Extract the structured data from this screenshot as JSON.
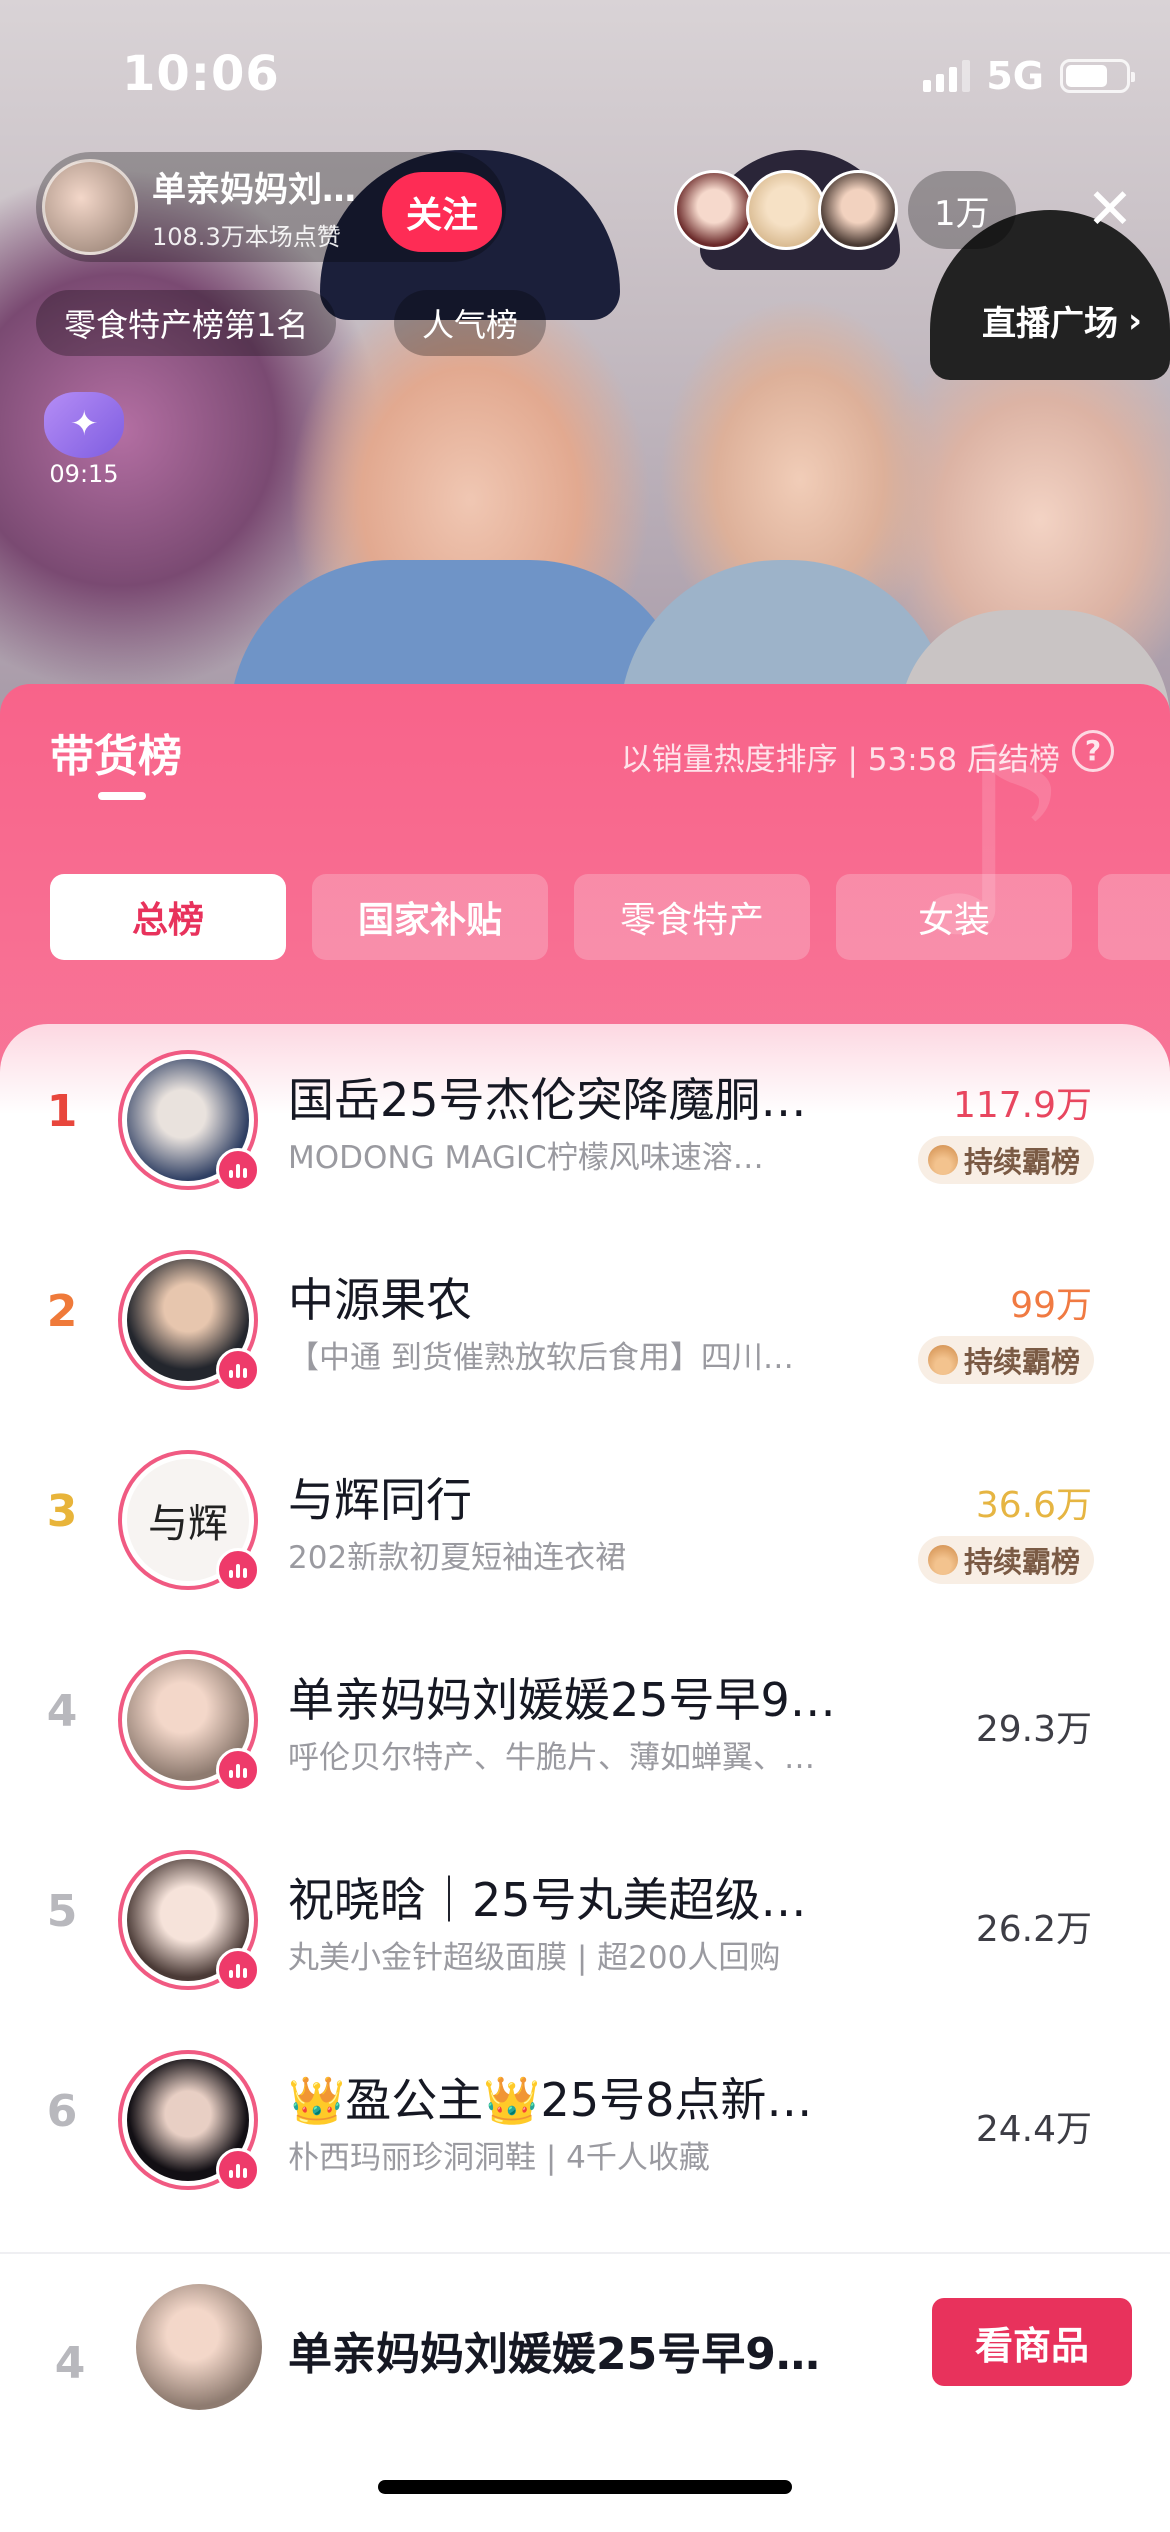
{
  "status_bar": {
    "time": "10:06",
    "network": "5G",
    "battery_percent": 70
  },
  "host": {
    "name": "单亲妈妈刘…",
    "likes": "108.3万本场点赞",
    "follow_label": "关注"
  },
  "viewers": {
    "count": "1万"
  },
  "chips": {
    "category_rank": "零食特产榜第1名",
    "popular": "人气榜"
  },
  "plaza": {
    "label": "直播广场",
    "chevron": "›"
  },
  "timer": {
    "label": "09:15"
  },
  "sheet": {
    "title": "带货榜",
    "meta": "以销量热度排序 | 53:58 后结榜",
    "help": "?",
    "watermark": "♪",
    "tabs": [
      {
        "label": "总榜"
      },
      {
        "label": "国家补贴"
      },
      {
        "label": "零食特产"
      },
      {
        "label": "女装"
      }
    ]
  },
  "rankings": [
    {
      "rank": "1",
      "name": "国岳25号杰伦突降魔胴…",
      "subtitle": "MODONG MAGIC柠檬风味速溶…",
      "value": "117.9万",
      "badge": "持续霸榜",
      "rank_color": "#e8463c",
      "value_color": "#e8465f"
    },
    {
      "rank": "2",
      "name": "中源果农",
      "subtitle": "【中通 到货催熟放软后食用】四川…",
      "value": "99万",
      "badge": "持续霸榜",
      "rank_color": "#ef7a3a",
      "value_color": "#f07a42"
    },
    {
      "rank": "3",
      "name": "与辉同行",
      "subtitle": "202新款初夏短袖连衣裙",
      "value": "36.6万",
      "badge": "持续霸榜",
      "rank_color": "#e8b43a",
      "value_color": "#e6b542"
    },
    {
      "rank": "4",
      "name": "单亲妈妈刘媛媛25号早9…",
      "subtitle": "呼伦贝尔特产、牛脆片、薄如蝉翼、…",
      "value": "29.3万"
    },
    {
      "rank": "5",
      "name": "祝晓晗｜25号丸美超级面…",
      "subtitle": "丸美小金针超级面膜 | 超200人回购",
      "value": "26.2万"
    },
    {
      "rank": "6",
      "name": "👑盈公主👑25号8点新…",
      "subtitle": "朴西玛丽珍洞洞鞋 | 4千人收藏",
      "value": "24.4万"
    }
  ],
  "current": {
    "rank": "4",
    "name": "单亲妈妈刘媛媛25号早9…",
    "button_label": "看商品"
  }
}
